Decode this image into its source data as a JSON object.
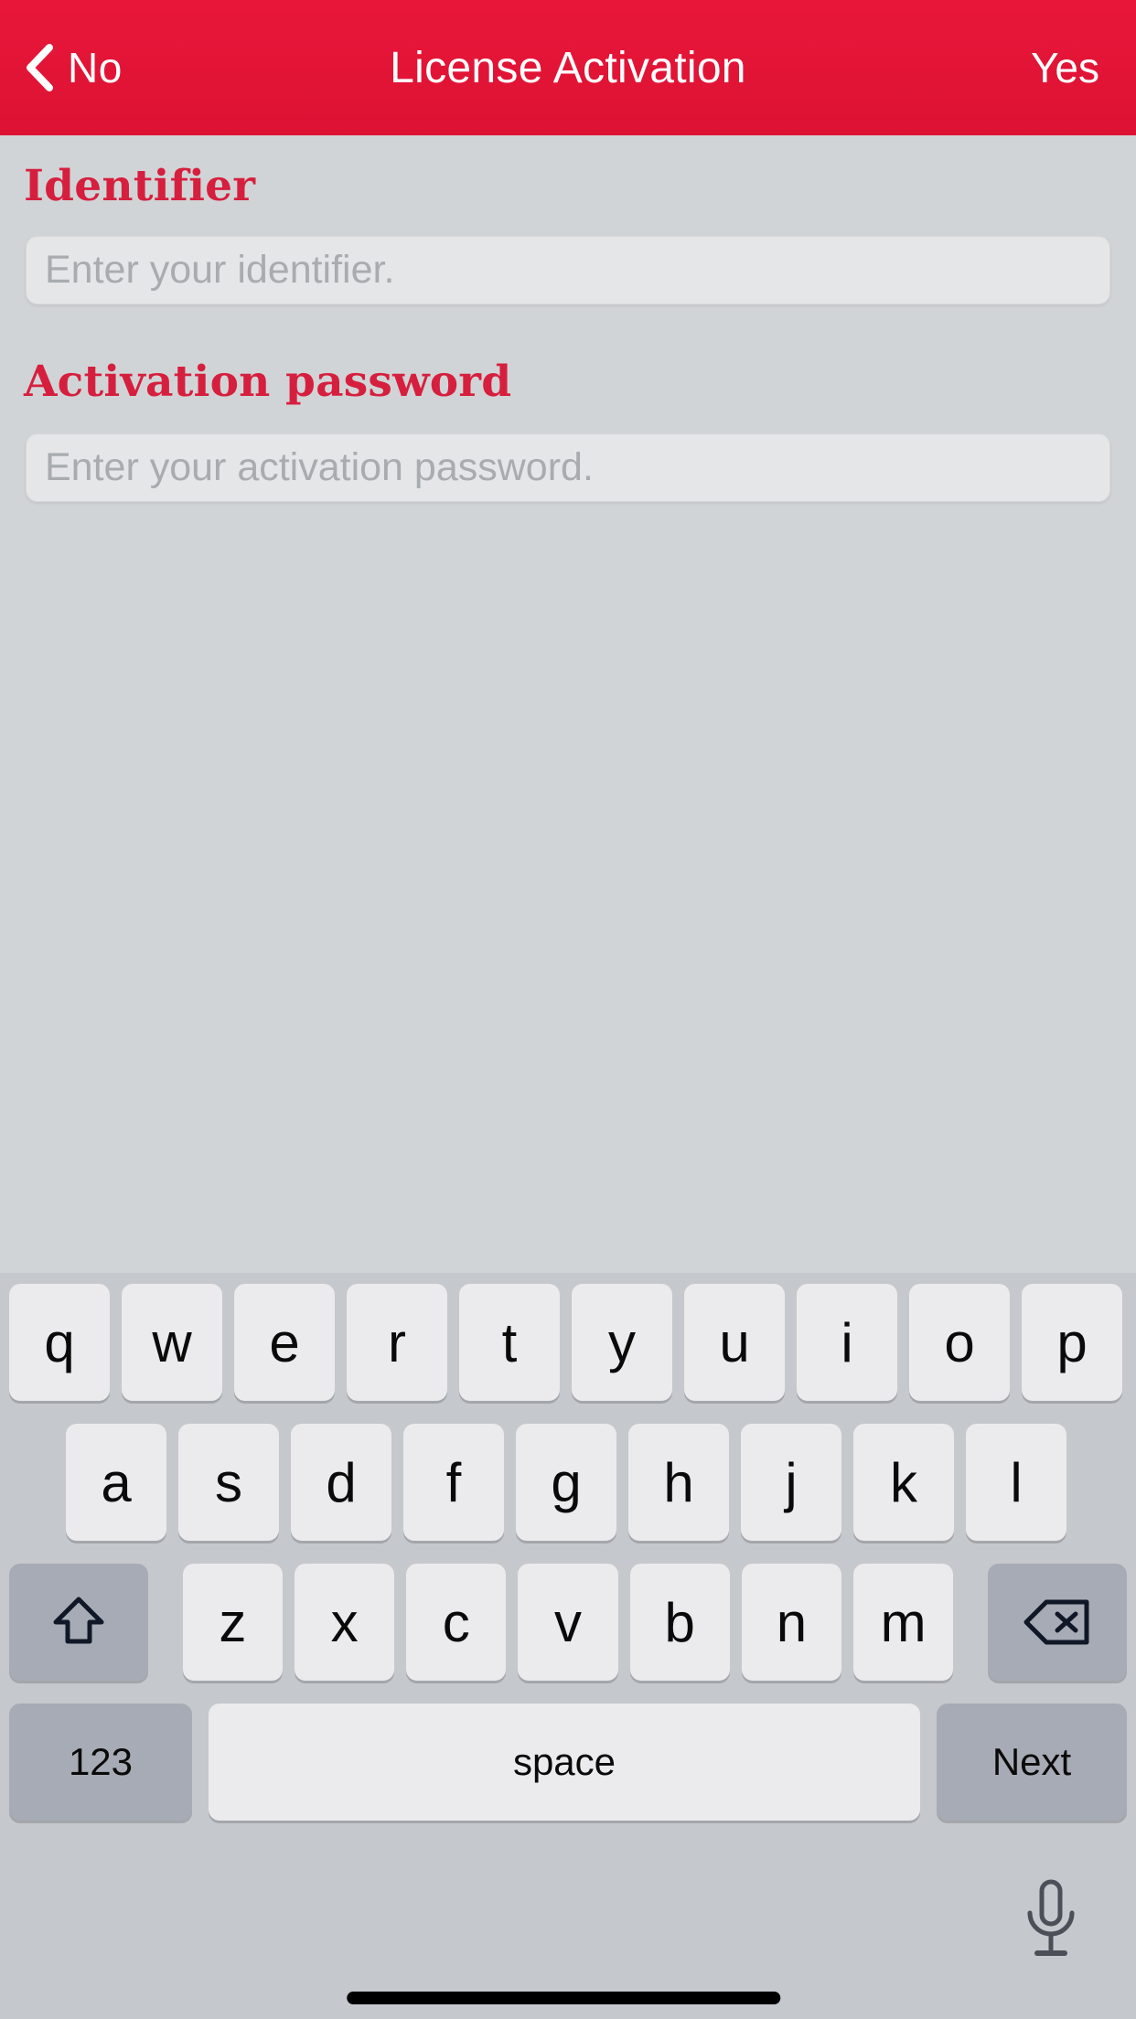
{
  "navbar": {
    "back_label": "No",
    "back_icon": "chevron-left-icon",
    "title": "License Activation",
    "confirm_label": "Yes",
    "background_color": "#e31837",
    "text_color": "#ffffff"
  },
  "form": {
    "accent_color": "#d61f3e",
    "fields": [
      {
        "label": "Identifier",
        "placeholder": "Enter your identifier.",
        "value": "",
        "type": "text"
      },
      {
        "label": "Activation password",
        "placeholder": "Enter your activation password.",
        "value": "",
        "type": "text"
      }
    ]
  },
  "keyboard": {
    "layout": "qwerty-lowercase",
    "background_color": "#c5c8cc",
    "key_color": "#ebebed",
    "function_key_color": "#a7abb5",
    "row1": [
      "q",
      "w",
      "e",
      "r",
      "t",
      "y",
      "u",
      "i",
      "o",
      "p"
    ],
    "row2": [
      "a",
      "s",
      "d",
      "f",
      "g",
      "h",
      "j",
      "k",
      "l"
    ],
    "row3_letters": [
      "z",
      "x",
      "c",
      "v",
      "b",
      "n",
      "m"
    ],
    "shift_icon": "shift-arrow-up-icon",
    "backspace_icon": "backspace-delete-icon",
    "numeric_label": "123",
    "space_label": "space",
    "return_label": "Next",
    "dictation_icon": "microphone-icon"
  },
  "system": {
    "home_indicator": "home-indicator-bar"
  }
}
